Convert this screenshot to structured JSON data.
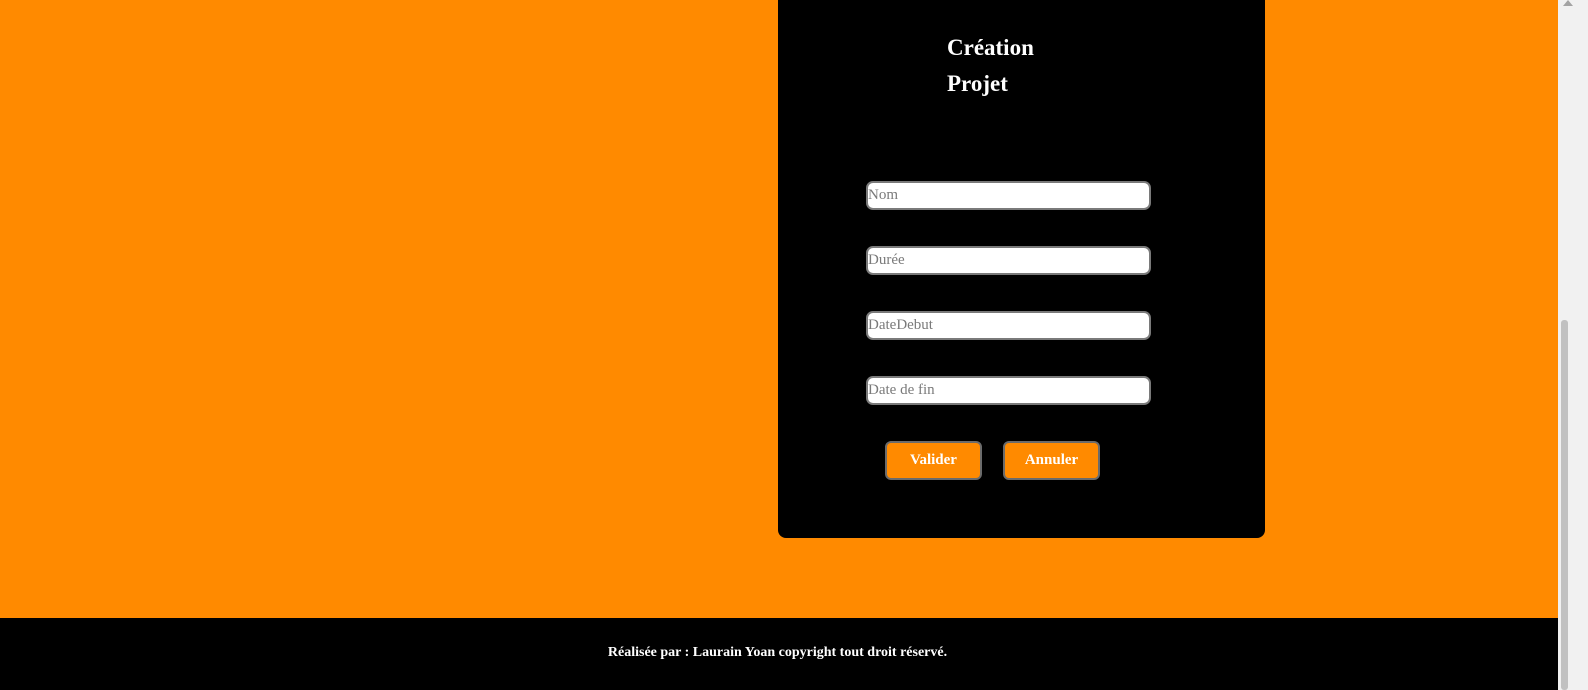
{
  "form": {
    "title": "Création Projet",
    "fields": [
      {
        "name": "nom",
        "placeholder": "Nom",
        "value": ""
      },
      {
        "name": "duree",
        "placeholder": "Durée",
        "value": ""
      },
      {
        "name": "date_debut",
        "placeholder": "DateDebut",
        "value": ""
      },
      {
        "name": "date_fin",
        "placeholder": "Date de fin",
        "value": ""
      }
    ],
    "validate_label": "Valider",
    "cancel_label": "Annuler"
  },
  "footer": {
    "text": "Réalisée par : Laurain Yoan copyright tout droit réservé."
  },
  "colors": {
    "background": "#ff8a00",
    "card": "#000000",
    "button": "#ff8a00",
    "footer": "#000000"
  }
}
